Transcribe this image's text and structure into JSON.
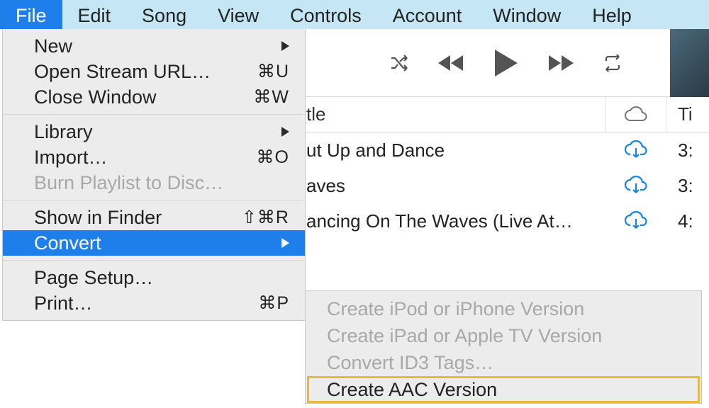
{
  "menubar": {
    "items": [
      {
        "label": "File",
        "active": true
      },
      {
        "label": "Edit"
      },
      {
        "label": "Song"
      },
      {
        "label": "View"
      },
      {
        "label": "Controls"
      },
      {
        "label": "Account"
      },
      {
        "label": "Window"
      },
      {
        "label": "Help"
      }
    ]
  },
  "file_menu": {
    "new": "New",
    "open_stream": "Open Stream URL…",
    "open_stream_sc": "⌘U",
    "close_window": "Close Window",
    "close_window_sc": "⌘W",
    "library": "Library",
    "import": "Import…",
    "import_sc": "⌘O",
    "burn": "Burn Playlist to Disc…",
    "show_finder": "Show in Finder",
    "show_finder_sc": "⇧⌘R",
    "convert": "Convert",
    "page_setup": "Page Setup…",
    "print": "Print…",
    "print_sc": "⌘P"
  },
  "convert_submenu": {
    "ipod": "Create iPod or iPhone Version",
    "ipad": "Create iPad or Apple TV Version",
    "id3": "Convert ID3 Tags…",
    "aac": "Create AAC Version"
  },
  "table": {
    "header_title": "tle",
    "header_time": "Ti",
    "rows": [
      {
        "title": "ut Up and Dance",
        "time": "3:"
      },
      {
        "title": "aves",
        "time": "3:"
      },
      {
        "title": "ancing On The Waves (Live At…",
        "time": "4:"
      }
    ]
  }
}
